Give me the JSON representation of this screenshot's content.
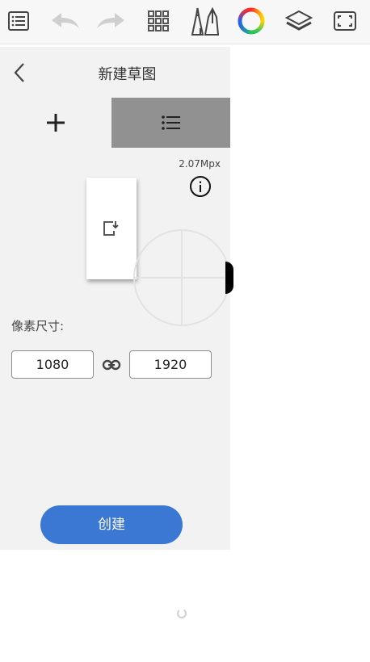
{
  "toolbar": {
    "icons": [
      "menu-list-icon",
      "undo-icon",
      "redo-icon",
      "grid-icon",
      "brush-tools-icon",
      "color-wheel-icon",
      "layers-icon",
      "fullscreen-icon"
    ]
  },
  "dialog": {
    "title": "新建草图",
    "megapixels": "2.07Mpx",
    "size_label": "像素尺寸:",
    "width_value": "1080",
    "height_value": "1920",
    "create_label": "创建"
  },
  "colors": {
    "accent": "#3a78d4",
    "tab_active_bg": "#919191",
    "panel_bg": "#f2f2f2"
  }
}
